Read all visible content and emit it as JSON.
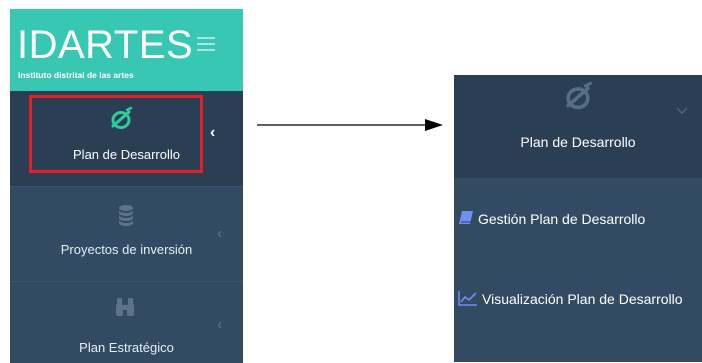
{
  "sidebar": {
    "brand": {
      "title": "IDARTES",
      "subtitle": "Instituto distrital de las artes"
    },
    "items": [
      {
        "label": "Plan de Desarrollo",
        "icon": "radar-icon",
        "chevron": "‹"
      },
      {
        "label": "Proyectos de inversión",
        "icon": "database-icon",
        "chevron": "‹"
      },
      {
        "label": "Plan Estratégico",
        "icon": "binoculars-icon",
        "chevron": "‹"
      }
    ]
  },
  "expanded_menu": {
    "title": "Plan de Desarrollo",
    "icon": "radar-icon",
    "submenu": [
      {
        "label": "Gestión Plan de Desarrollo",
        "icon": "book-icon"
      },
      {
        "label": "Visualización Plan de Desarrollo",
        "icon": "line-chart-icon"
      }
    ]
  },
  "colors": {
    "sidebar_bg": "#2a3f54",
    "item_bg": "#324b62",
    "brand_bg": "#38c7b3",
    "accent_icon": "#2ecc9a",
    "highlight": "#e3202a"
  }
}
